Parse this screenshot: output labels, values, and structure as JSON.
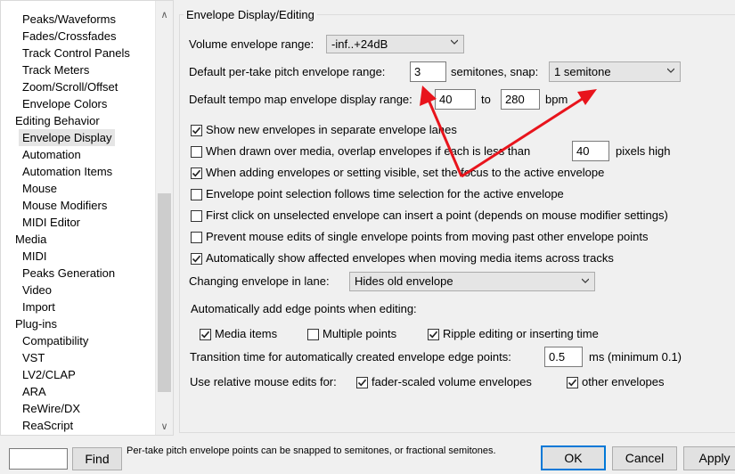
{
  "sidebar": {
    "items": [
      {
        "label": "Peaks/Waveforms",
        "indent": 1
      },
      {
        "label": "Fades/Crossfades",
        "indent": 1
      },
      {
        "label": "Track Control Panels",
        "indent": 1
      },
      {
        "label": "Track Meters",
        "indent": 1
      },
      {
        "label": "Zoom/Scroll/Offset",
        "indent": 1
      },
      {
        "label": "Envelope Colors",
        "indent": 1
      },
      {
        "label": "Editing Behavior",
        "indent": 0
      },
      {
        "label": "Envelope Display",
        "indent": 1,
        "selected": true
      },
      {
        "label": "Automation",
        "indent": 1
      },
      {
        "label": "Automation Items",
        "indent": 1
      },
      {
        "label": "Mouse",
        "indent": 1
      },
      {
        "label": "Mouse Modifiers",
        "indent": 1
      },
      {
        "label": "MIDI Editor",
        "indent": 1
      },
      {
        "label": "Media",
        "indent": 0
      },
      {
        "label": "MIDI",
        "indent": 1
      },
      {
        "label": "Peaks Generation",
        "indent": 1
      },
      {
        "label": "Video",
        "indent": 1
      },
      {
        "label": "Import",
        "indent": 1
      },
      {
        "label": "Plug-ins",
        "indent": 0
      },
      {
        "label": "Compatibility",
        "indent": 1
      },
      {
        "label": "VST",
        "indent": 1
      },
      {
        "label": "LV2/CLAP",
        "indent": 1
      },
      {
        "label": "ARA",
        "indent": 1
      },
      {
        "label": "ReWire/DX",
        "indent": 1
      },
      {
        "label": "ReaScript",
        "indent": 1
      }
    ]
  },
  "section_title": "Envelope Display/Editing",
  "volume_range": {
    "label": "Volume envelope range:",
    "value": "-inf..+24dB"
  },
  "pitch_range": {
    "label": "Default per-take pitch envelope range:",
    "value": "3",
    "unit": "semitones, snap:",
    "snap_value": "1 semitone"
  },
  "tempo_range": {
    "label": "Default tempo map envelope display range:",
    "min": "40",
    "to": "to",
    "max": "280",
    "unit": "bpm"
  },
  "options": {
    "show_separate_lanes": {
      "label": "Show new envelopes in separate envelope lanes",
      "checked": true
    },
    "overlap": {
      "label": "When drawn over media, overlap envelopes if each is less than",
      "checked": false,
      "value": "40",
      "unit": "pixels high"
    },
    "focus": {
      "label": "When adding envelopes or setting visible, set the focus to the active envelope",
      "checked": true
    },
    "point_selection": {
      "label": "Envelope point selection follows time selection for the active envelope",
      "checked": false
    },
    "first_click": {
      "label": "First click on unselected envelope can insert a point (depends on mouse modifier settings)",
      "checked": false
    },
    "prevent_edits": {
      "label": "Prevent mouse edits of single envelope points from moving past other envelope points",
      "checked": false
    },
    "auto_show": {
      "label": "Automatically show affected envelopes when moving media items across tracks",
      "checked": true
    }
  },
  "changing_lane": {
    "label": "Changing envelope in lane:",
    "value": "Hides old envelope"
  },
  "edge_points": {
    "label": "Automatically add edge points when editing:",
    "media_items": {
      "label": "Media items",
      "checked": true
    },
    "multiple_points": {
      "label": "Multiple points",
      "checked": false
    },
    "ripple": {
      "label": "Ripple editing or inserting time",
      "checked": true
    }
  },
  "transition": {
    "label": "Transition time for automatically created envelope edge points:",
    "value": "0.5",
    "unit": "ms (minimum 0.1)"
  },
  "relative": {
    "label": "Use relative mouse edits for:",
    "fader_scaled": {
      "label": "fader-scaled volume envelopes",
      "checked": true
    },
    "other": {
      "label": "other envelopes",
      "checked": true
    }
  },
  "footer": {
    "find_input_value": "",
    "find_label": "Find",
    "hint": "Per-take pitch envelope points can be snapped to semitones, or fractional semitones.",
    "ok_label": "OK",
    "cancel_label": "Cancel",
    "apply_label": "Apply"
  },
  "annotation": {
    "arrow_color": "#e8141c"
  },
  "icons": {
    "dropdown": "chevron-down-icon",
    "check": "checkmark-icon"
  }
}
